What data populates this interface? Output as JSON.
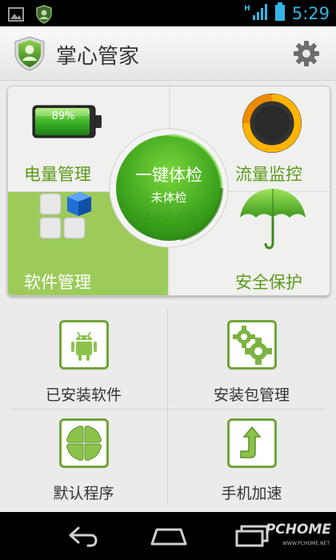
{
  "status_bar": {
    "time": "5:29",
    "network": "H",
    "icons": [
      "gallery-icon",
      "shield-notification-icon",
      "signal-icon",
      "battery-icon"
    ],
    "time_color": "#33b5e5"
  },
  "header": {
    "title": "掌心管家",
    "icons": [
      "shield-logo-icon",
      "gear-icon"
    ]
  },
  "panel": {
    "power": {
      "label": "电量管理",
      "battery_percent": "89%"
    },
    "traffic": {
      "label": "流量监控"
    },
    "software": {
      "label": "软件管理"
    },
    "security": {
      "label": "安全保护"
    },
    "checkup": {
      "title": "一键体检",
      "status": "未体检",
      "stars": "☆☆☆☆☆"
    }
  },
  "grid": {
    "items": [
      {
        "label": "已安装软件",
        "icon": "android-icon"
      },
      {
        "label": "安装包管理",
        "icon": "gears-icon"
      },
      {
        "label": "默认程序",
        "icon": "clover-icon"
      },
      {
        "label": "手机加速",
        "icon": "arrow-up-icon"
      }
    ]
  },
  "nav_bar": {
    "buttons": [
      "back-icon",
      "home-icon",
      "recent-apps-icon"
    ]
  },
  "watermark": {
    "text": "PCHOME",
    "subtext": "WWW.PCHOME.NET"
  },
  "colors": {
    "accent_green": "#5b9a1b",
    "selected_cell": "#9ccb5a",
    "icon_border": "#6fa538"
  }
}
